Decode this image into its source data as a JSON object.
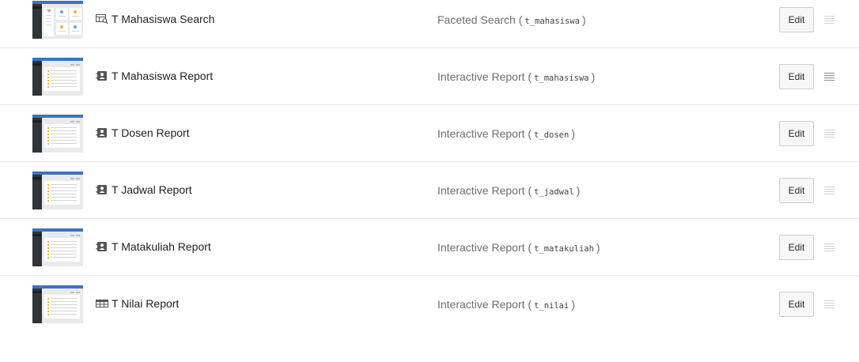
{
  "pages": [
    {
      "title": "T Mahasiswa Search",
      "type_label": "Faceted Search",
      "table": "t_mahasiswa",
      "icon": "faceted-search-icon",
      "thumbnail": "faceted-search-thumbnail",
      "edit_label": "Edit"
    },
    {
      "title": "T Mahasiswa Report",
      "type_label": "Interactive Report",
      "table": "t_mahasiswa",
      "icon": "interactive-report-icon",
      "thumbnail": "report-thumbnail",
      "edit_label": "Edit"
    },
    {
      "title": "T Dosen Report",
      "type_label": "Interactive Report",
      "table": "t_dosen",
      "icon": "interactive-report-icon",
      "thumbnail": "report-thumbnail",
      "edit_label": "Edit"
    },
    {
      "title": "T Jadwal Report",
      "type_label": "Interactive Report",
      "table": "t_jadwal",
      "icon": "interactive-report-icon",
      "thumbnail": "report-thumbnail",
      "edit_label": "Edit"
    },
    {
      "title": "T Matakuliah Report",
      "type_label": "Interactive Report",
      "table": "t_matakuliah",
      "icon": "interactive-report-icon",
      "thumbnail": "report-thumbnail",
      "edit_label": "Edit"
    },
    {
      "title": "T Nilai Report",
      "type_label": "Interactive Report",
      "table": "t_nilai",
      "icon": "table-grid-icon",
      "thumbnail": "report-thumbnail",
      "edit_label": "Edit"
    }
  ],
  "colors": {
    "accent_blue": "#3e72c1",
    "sidebar_dark": "#2f3539",
    "highlight_yellow": "#f3b537",
    "row_divider": "#e8e8e8"
  }
}
